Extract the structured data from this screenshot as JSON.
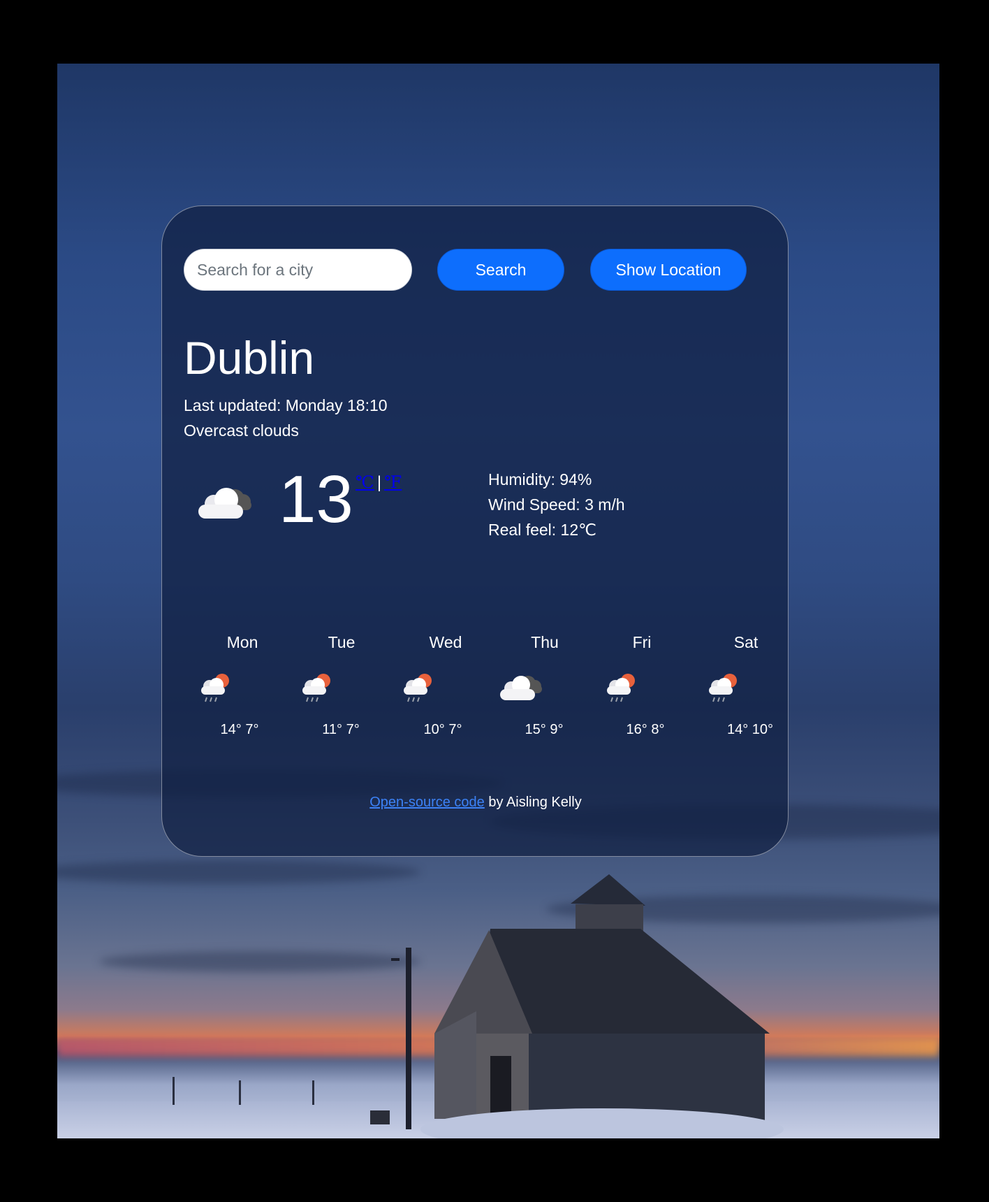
{
  "search": {
    "placeholder": "Search for a city",
    "search_label": "Search",
    "location_label": "Show Location"
  },
  "current": {
    "city": "Dublin",
    "updated": "Last updated: Monday 18:10",
    "description": "Overcast clouds",
    "icon": "overcast-clouds-icon",
    "temperature": "13",
    "unit_celsius": "℃",
    "unit_separator": "|",
    "unit_fahrenheit": "℉",
    "humidity": "Humidity: 94%",
    "wind": "Wind Speed: 3 m/h",
    "real_feel": "Real feel: 12℃"
  },
  "forecast": [
    {
      "day": "Mon",
      "icon": "rain-sun-icon",
      "temps": "14° 7°"
    },
    {
      "day": "Tue",
      "icon": "rain-sun-icon",
      "temps": "11° 7°"
    },
    {
      "day": "Wed",
      "icon": "rain-sun-icon",
      "temps": "10° 7°"
    },
    {
      "day": "Thu",
      "icon": "overcast-clouds-icon",
      "temps": "15° 9°"
    },
    {
      "day": "Fri",
      "icon": "rain-sun-icon",
      "temps": "16° 8°"
    },
    {
      "day": "Sat",
      "icon": "rain-sun-icon",
      "temps": "14° 10°"
    }
  ],
  "footer": {
    "link_text": "Open-source code",
    "author_text": " by Aisling Kelly"
  },
  "colors": {
    "button": "#0d6efd",
    "link": "#0000ee",
    "footer_link": "#3c82f6",
    "card": "#102042",
    "sun": "#e8613c"
  }
}
